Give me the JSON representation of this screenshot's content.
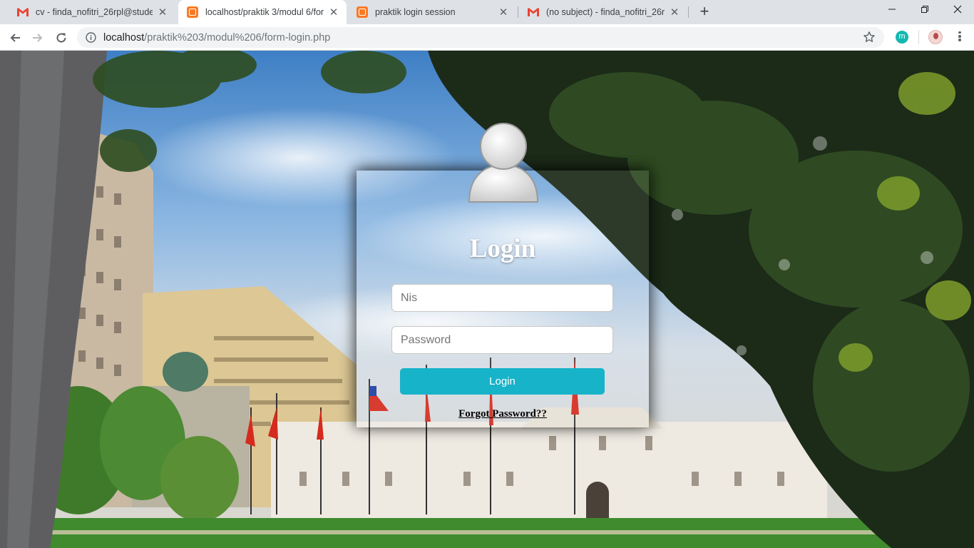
{
  "browser": {
    "tabs": [
      {
        "title": "cv - finda_nofitri_26rpl@student.",
        "favicon": "gmail-icon",
        "active": false
      },
      {
        "title": "localhost/praktik 3/modul 6/form",
        "favicon": "xampp-icon",
        "active": true
      },
      {
        "title": "praktik login session",
        "favicon": "xampp-icon",
        "active": false
      },
      {
        "title": "(no subject) - finda_nofitri_26rpl@",
        "favicon": "gmail-icon",
        "active": false
      }
    ],
    "new_tab": "+",
    "url": {
      "host": "localhost",
      "path": "/praktik%203/modul%206/form-login.php"
    },
    "extension_label": "m"
  },
  "login": {
    "title": "Login",
    "nis_placeholder": "Nis",
    "password_placeholder": "Password",
    "button_label": "Login",
    "forgot_link": "Forgot Password??"
  },
  "colors": {
    "accent_button": "#17b3c9",
    "gmail_red": "#ea4335",
    "xampp_orange": "#fb7a24"
  }
}
